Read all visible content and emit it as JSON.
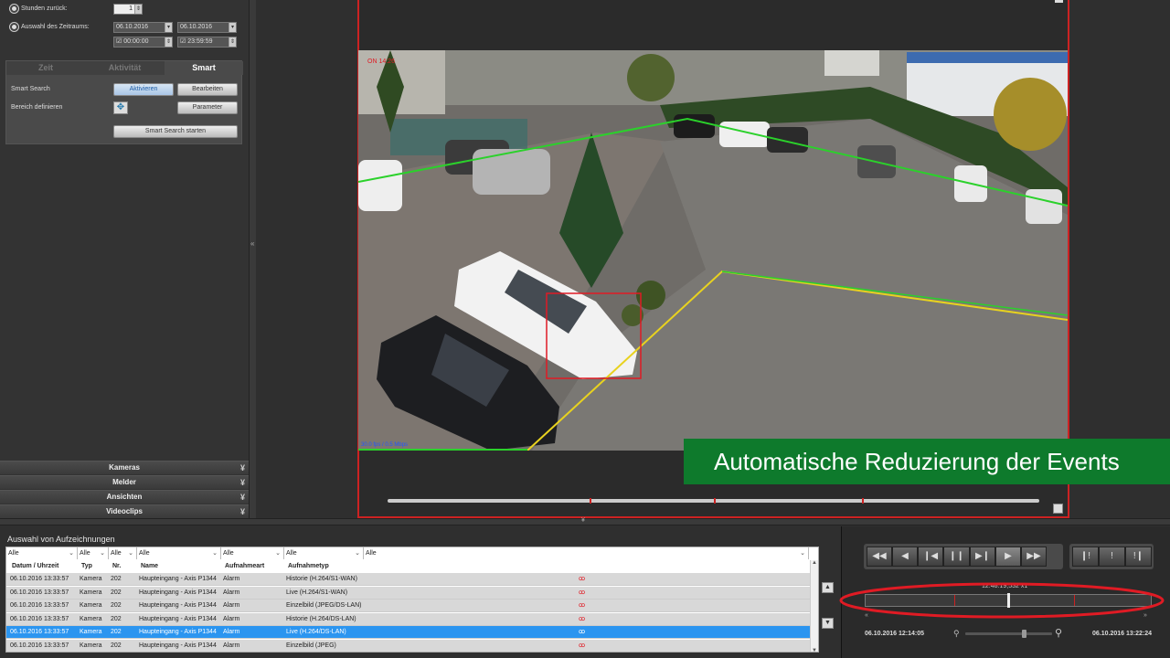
{
  "search_panel": {
    "hours_back_label": "Stunden zurück:",
    "hours_back_value": "1",
    "period_label": "Auswahl des Zeitraums:",
    "from_date": "06.10.2016",
    "to_date": "06.10.2016",
    "from_time": "00:00:00",
    "to_time": "23:59:59",
    "tabs": [
      "Zeit",
      "Aktivität",
      "Smart"
    ],
    "active_tab": "Smart",
    "smart_search_label": "Smart Search",
    "activate_button": "Aktivieren",
    "edit_button": "Bearbeiten",
    "define_area_label": "Bereich definieren",
    "parameters_button": "Parameter",
    "start_button": "Smart Search starten"
  },
  "accordion": [
    "Kameras",
    "Melder",
    "Ansichten",
    "Videoclips"
  ],
  "video": {
    "overlay_top_left": "ON 14:26",
    "overlay_bottom_left": "30.0 fps / 0.5 Mbps",
    "banner_text": "Automatische Reduzierung der Events"
  },
  "recordings": {
    "title": "Auswahl von Aufzeichnungen",
    "filters": [
      "Alle",
      "Alle",
      "Alle",
      "Alle",
      "Alle",
      "Alle",
      "Alle"
    ],
    "headers": [
      "Datum / Uhrzeit",
      "Typ",
      "Nr.",
      "Name",
      "Aufnahmeart",
      "Aufnahmetyp"
    ],
    "rows": [
      [
        "06.10.2016 13:33:57",
        "Kamera",
        "202",
        "Haupteingang - Axis P1344",
        "Alarm",
        "Historie (H.264/S1-WAN)"
      ],
      [
        "06.10.2016 13:33:57",
        "Kamera",
        "202",
        "Haupteingang - Axis P1344",
        "Alarm",
        "Live (H.264/S1-WAN)"
      ],
      [
        "06.10.2016 13:33:57",
        "Kamera",
        "202",
        "Haupteingang - Axis P1344",
        "Alarm",
        "Einzelbild (JPEG/DS-LAN)"
      ],
      [
        "06.10.2016 13:33:57",
        "Kamera",
        "202",
        "Haupteingang - Axis P1344",
        "Alarm",
        "Historie (H.264/DS-LAN)"
      ],
      [
        "06.10.2016 13:33:57",
        "Kamera",
        "202",
        "Haupteingang - Axis P1344",
        "Alarm",
        "Live (H.264/DS-LAN)"
      ],
      [
        "06.10.2016 13:33:57",
        "Kamera",
        "202",
        "Haupteingang - Axis P1344",
        "Alarm",
        "Einzelbild (JPEG)"
      ]
    ],
    "selected_row": 4
  },
  "playback": {
    "timestamp": "12:48:19,532 x1",
    "start_time": "06.10.2016 12:14:05",
    "end_time": "06.10.2016 13:22:24",
    "colors": {
      "accent": "#e01b24",
      "banner": "#0e7a2c",
      "selection": "#2b95f0"
    }
  }
}
